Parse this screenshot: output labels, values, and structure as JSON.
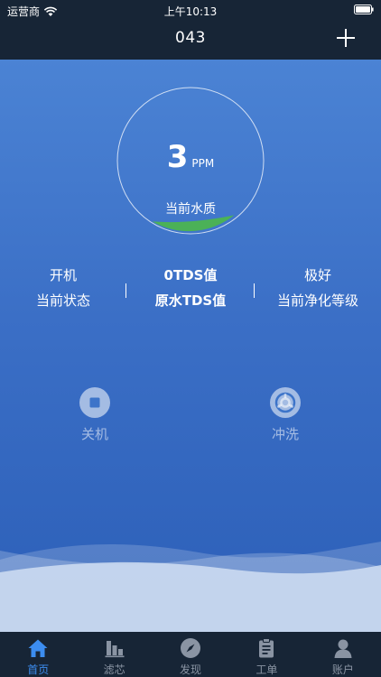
{
  "status_bar": {
    "carrier": "运营商",
    "time": "上午10:13"
  },
  "nav": {
    "title": "043"
  },
  "gauge": {
    "value": "3",
    "unit": "PPM",
    "label": "当前水质",
    "fill_fraction": 0.1
  },
  "stats": [
    {
      "value": "开机",
      "label": "当前状态"
    },
    {
      "value": "0TDS值",
      "label": "原水TDS值"
    },
    {
      "value": "极好",
      "label": "当前净化等级"
    }
  ],
  "actions": {
    "power_label": "关机",
    "flush_label": "冲洗"
  },
  "tabs": [
    {
      "label": "首页",
      "icon": "home-icon",
      "active": true
    },
    {
      "label": "滤芯",
      "icon": "filter-chart-icon",
      "active": false
    },
    {
      "label": "发现",
      "icon": "compass-icon",
      "active": false
    },
    {
      "label": "工单",
      "icon": "clipboard-icon",
      "active": false
    },
    {
      "label": "账户",
      "icon": "user-icon",
      "active": false
    }
  ],
  "colors": {
    "accent": "#3c8df0",
    "gauge_fill": "#4cb84a",
    "nav_bg": "#172536",
    "main_bg_top": "#4b83d4",
    "main_bg_bottom": "#2c5fb8"
  }
}
